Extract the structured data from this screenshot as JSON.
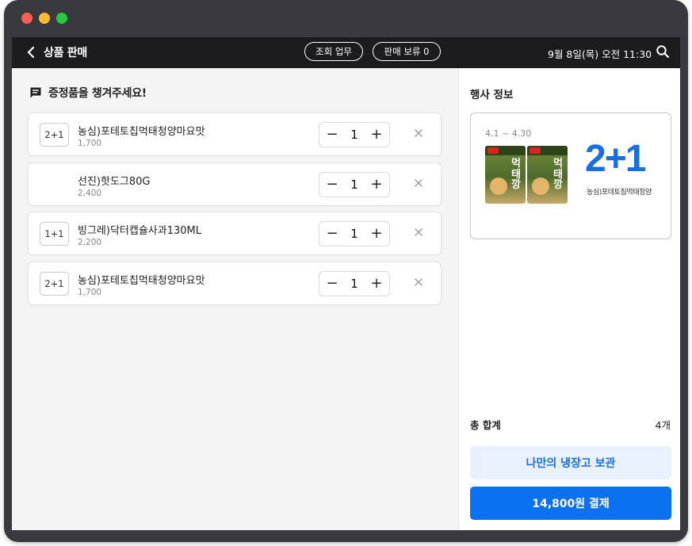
{
  "window": {
    "controls": [
      "close",
      "minimize",
      "zoom"
    ]
  },
  "header": {
    "back_icon": "chevron-left-icon",
    "title": "상품 판매",
    "inquiry_label": "조회 업무",
    "hold_label": "판매 보류 0",
    "datetime": "9월 8일(목) 오전 11:30",
    "search_icon": "search-icon"
  },
  "notice": {
    "icon": "message-icon",
    "text": "증정품을 챙겨주세요!"
  },
  "items": [
    {
      "badge": "2+1",
      "name": "농심)포테토칩먹태청양마요맛",
      "price": "1,700",
      "qty": "1"
    },
    {
      "badge": "",
      "name": "선진)핫도그80G",
      "price": "2,400",
      "qty": "1"
    },
    {
      "badge": "1+1",
      "name": "빙그레)닥터캡슐사과130ML",
      "price": "2,200",
      "qty": "1"
    },
    {
      "badge": "2+1",
      "name": "농심)포테토칩먹태청양마요맛",
      "price": "1,700",
      "qty": "1"
    }
  ],
  "stepper": {
    "minus": "−",
    "plus": "+"
  },
  "event": {
    "title": "행사 정보",
    "period": "4.1 ~ 4.30",
    "promo": "2+1",
    "product": "농심)포테토칩먹태청양",
    "pack_text": "먹태깡"
  },
  "summary": {
    "total_label": "총 합계",
    "total_count": "4개"
  },
  "actions": {
    "store_label": "나만의 냉장고 보관",
    "pay_label": "14,800원 결제"
  },
  "colors": {
    "accent": "#0a72f0",
    "accent_light": "#e8f1fd",
    "topbar": "#1c1c1e"
  }
}
